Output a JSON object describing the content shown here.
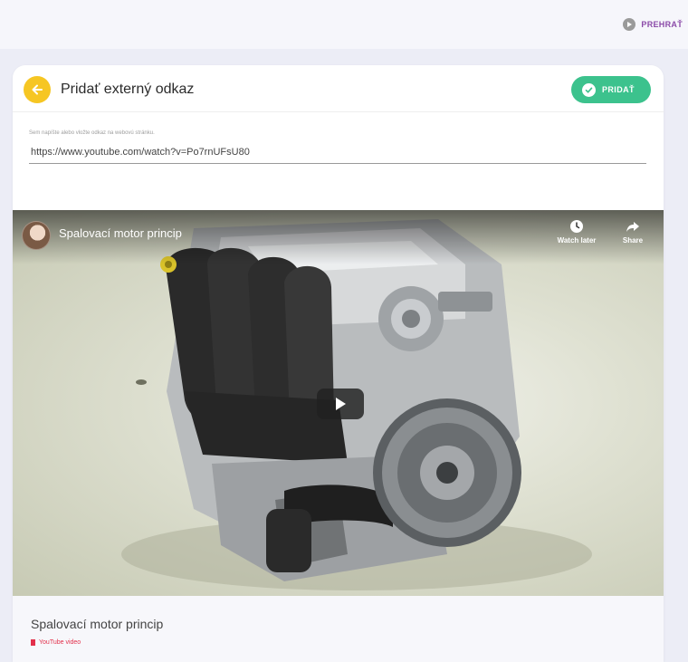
{
  "topbar": {
    "play_label": "PREHRAŤ"
  },
  "dialog": {
    "title": "Pridať externý odkaz",
    "add_label": "PRIDAŤ",
    "url_hint": "Sem napíšte alebo vložte odkaz na webovú stránku.",
    "url_value": "https://www.youtube.com/watch?v=Po7rnUFsU80"
  },
  "video": {
    "title": "Spalovací motor princip",
    "watch_later_label": "Watch later",
    "share_label": "Share"
  },
  "preview": {
    "title": "Spalovací motor princip",
    "source_label": "YouTube video"
  },
  "colors": {
    "accent_yellow": "#f6c623",
    "accent_green": "#3cc28d",
    "source_red": "#e2304b",
    "link_purple": "#8b4aa8"
  }
}
